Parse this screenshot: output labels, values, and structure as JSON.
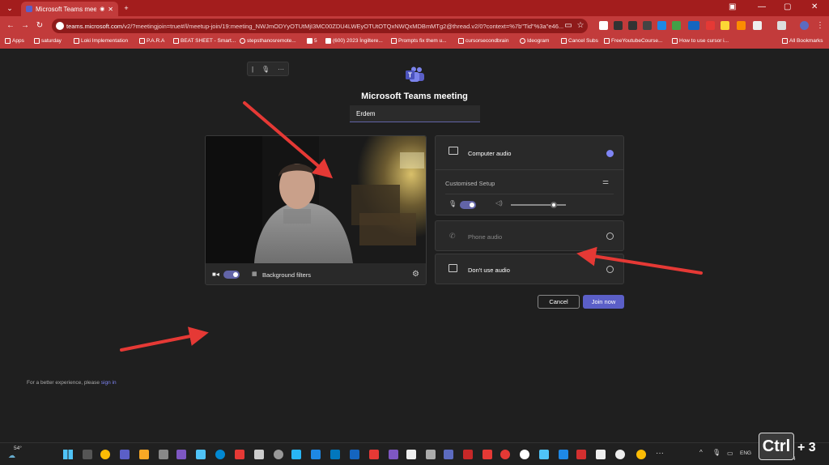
{
  "browser": {
    "tab_title": "Microsoft Teams meeting |",
    "url_host": "teams.microsoft.com",
    "url_path": "/v2/?meetingjoin=true#/l/meetup-join/19:meeting_NWJmODYyOTUtMjI3MC00ZDU4LWEyOTUtOTQxNWQxMDBmMTg2@thread.v2/0?context=%7b\"Tid\"%3a\"e46...",
    "bookmarks": [
      "Apps",
      "saturday",
      "Loki Implementation",
      "P.A.R.A",
      "BEAT SHEET - Smart...",
      "stepsthanosremote...",
      "5",
      "(600) 2023 İngiltere...",
      "Prompts fix them u...",
      "cursorsecondbrain",
      "Ideogram",
      "Cancel Subs",
      "FreeYoutubeCourse...",
      "How to use cursor i...",
      "All Bookmarks"
    ]
  },
  "prejoin": {
    "title": "Microsoft Teams meeting",
    "name_value": "Erdem",
    "video_label": "Background filters",
    "audio": {
      "computer_audio": "Computer audio",
      "custom_setup": "Customised Setup",
      "phone_audio": "Phone audio",
      "no_audio": "Don't use audio",
      "speaker_volume": 0.8
    },
    "cancel": "Cancel",
    "join": "Join now",
    "footer_text": "For a better experience, please",
    "footer_link": "sign in"
  },
  "taskbar": {
    "weather": "54°",
    "lang": "ENG",
    "date": "19/10/2024"
  },
  "overlay": {
    "ctrl": "Ctrl",
    "plus": "+ 3"
  },
  "colors": {
    "chrome": "#c23b3b",
    "accent": "#6264a7",
    "join": "#5b5fc7",
    "arrow": "#e53935"
  }
}
